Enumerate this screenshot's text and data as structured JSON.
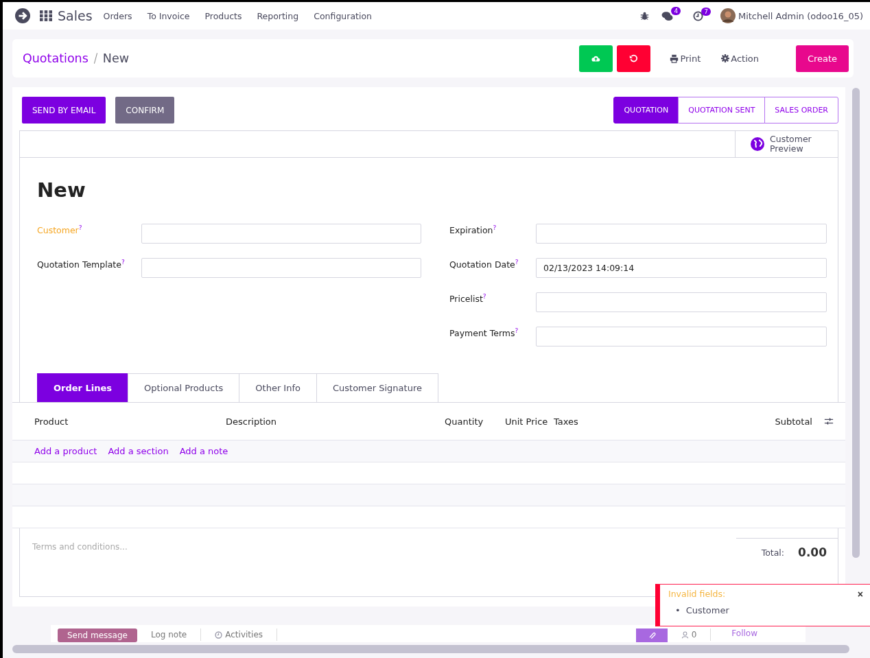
{
  "navbar": {
    "app": "Sales",
    "menus": [
      "Orders",
      "To Invoice",
      "Products",
      "Reporting",
      "Configuration"
    ],
    "messages_count": "4",
    "activities_count": "7",
    "user": "Mitchell Admin (odoo16_05)"
  },
  "breadcrumb": {
    "parent": "Quotations",
    "current": "New"
  },
  "control_panel": {
    "print": "Print",
    "action": "Action",
    "create": "Create"
  },
  "header_buttons": [
    {
      "label": "SEND BY EMAIL",
      "kind": "primary"
    },
    {
      "label": "CONFIRM",
      "kind": "secondary"
    }
  ],
  "status_steps": [
    {
      "label": "QUOTATION",
      "selected": true
    },
    {
      "label": "QUOTATION SENT",
      "selected": false
    },
    {
      "label": "SALES ORDER",
      "selected": false
    }
  ],
  "smart_button": "Customer Preview",
  "title": "New",
  "left_fields": [
    {
      "label": "Customer",
      "help": "?",
      "invalid": true
    },
    {
      "label": "Quotation Template",
      "help": "?",
      "invalid": false
    }
  ],
  "right_fields": [
    {
      "label": "Expiration",
      "help": "?",
      "invalid": false
    },
    {
      "label": "Quotation Date",
      "help": "?",
      "invalid": false,
      "value": "02/13/2023 14:09:14"
    },
    {
      "label": "Pricelist",
      "help": "?",
      "invalid": false
    },
    {
      "label": "Payment Terms",
      "help": "?",
      "invalid": false
    }
  ],
  "tabs": [
    {
      "label": "Order Lines",
      "selected": true
    },
    {
      "label": "Optional Products",
      "selected": false
    },
    {
      "label": "Other Info",
      "selected": false
    },
    {
      "label": "Customer Signature",
      "selected": false
    }
  ],
  "table": {
    "columns": [
      "Product",
      "Description",
      "Quantity",
      "Unit Price",
      "Taxes",
      "Subtotal"
    ],
    "add_links": [
      "Add a product",
      "Add a section",
      "Add a note"
    ]
  },
  "terms": {
    "placeholder": "Terms and conditions..."
  },
  "total": {
    "label": "Total:",
    "value": "0.00"
  },
  "chatter": {
    "buttons": [
      "Send message",
      "Log note",
      "Activities"
    ],
    "followers": "0",
    "follow": "Follow"
  },
  "toast": {
    "title": "Invalid fields:",
    "items": [
      {
        "marker": "•",
        "text": "Customer"
      }
    ],
    "close": "×"
  }
}
